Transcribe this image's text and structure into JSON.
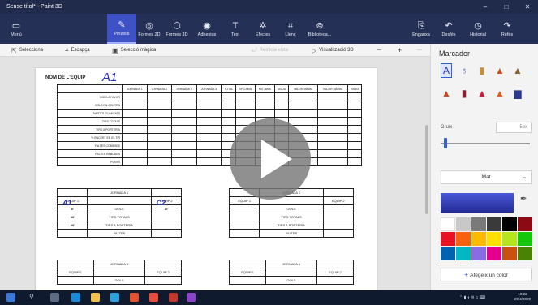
{
  "titlebar": {
    "title": "Sense títol* - Paint 3D",
    "min": "–",
    "max": "□",
    "close": "✕"
  },
  "ribbon": {
    "menu": "Menú",
    "tools": [
      {
        "label": "Pinzells",
        "icon": "✎"
      },
      {
        "label": "Formes 2D",
        "icon": "◎"
      },
      {
        "label": "Formes 3D",
        "icon": "⬡"
      },
      {
        "label": "Adhesius",
        "icon": "◉"
      },
      {
        "label": "Text",
        "icon": "T"
      },
      {
        "label": "Efectes",
        "icon": "✲"
      },
      {
        "label": "Llenç",
        "icon": "⌗"
      },
      {
        "label": "Biblioteca...",
        "icon": "⊚"
      }
    ],
    "right": [
      {
        "label": "Enganxa",
        "icon": "⎘"
      },
      {
        "label": "Desfés",
        "icon": "↶"
      },
      {
        "label": "Historial",
        "icon": "◷"
      },
      {
        "label": "Refés",
        "icon": "↷"
      }
    ]
  },
  "cmdbar": {
    "select": "Selecciona",
    "crop": "Escapça",
    "magic": "Selecció màgica",
    "flip": "Reinicia vista",
    "view3d": "Visualització 3D",
    "zoom_out": "—",
    "zoom_in": "+",
    "more": "···"
  },
  "sheet": {
    "name_label": "NOM DE L'EQUIP",
    "handwritten_name": "A1",
    "headers": [
      "",
      "JORNADA 1",
      "JORNADA 2",
      "JORNADA 3",
      "JORNADA 4",
      "TOTAL",
      "Nº CAMA",
      "MITJANA",
      "MODA",
      "VALOR MÍNIM",
      "VALOR MÀXIM",
      "RANG"
    ],
    "rows": [
      "GOLS A FAVOR",
      "GOLS EN CONTRA",
      "PARTITS GUANYATS",
      "TIRS TOTALS",
      "TIRS A PORTERIA",
      "% ENCERT EN EL TIR",
      "FALTES COMESES",
      "FALTES REBUDES",
      "PUNTS"
    ],
    "jornada1": {
      "title": "JORNADA 1",
      "team1": "EQUIP 1",
      "team2": "EQUIP 2",
      "hw_team1": "A1",
      "hw_team2": "C2",
      "rows": [
        "GOLS",
        "TIRS TOTALS",
        "TIRS A PORTERIA",
        "FALTES"
      ],
      "hw_marks_left": [
        "II",
        "IIII",
        "IIII"
      ],
      "hw_marks_right": [
        "III"
      ]
    },
    "jornada2": {
      "title": "JORNADA 2",
      "team1": "EQUIP 1",
      "team2": "EQUIP 2",
      "rows": [
        "GOLS",
        "TIRS TOTALS",
        "TIRS A PORTERIA",
        "FALTES"
      ]
    },
    "jornada3": {
      "title": "JORNADA 3",
      "team1": "EQUIP 1",
      "team2": "EQUIP 2",
      "rows": [
        "GOLS"
      ]
    },
    "jornada4": {
      "title": "JORNADA 4",
      "team1": "EQUIP 1",
      "team2": "EQUIP 2",
      "rows": [
        "GOLS"
      ]
    }
  },
  "panel": {
    "title": "Marcador",
    "size_label": "Gruix",
    "size_value": "5px",
    "finish": "Mat",
    "add_color": "Afegeix un color",
    "selected_color": "#3a45c4",
    "palette": [
      "#ffffff",
      "#c8c8c8",
      "#7a7a7a",
      "#3a3a3a",
      "#000000",
      "#8b0a14",
      "#e81224",
      "#f7630c",
      "#ffb900",
      "#fce100",
      "#b5e61d",
      "#16c60c",
      "#0063b1",
      "#00b7c3",
      "#886ce4",
      "#e3008c",
      "#ca5010",
      "#498205"
    ]
  },
  "taskbar": {
    "time": "19:22",
    "date": "20/4/2020"
  }
}
